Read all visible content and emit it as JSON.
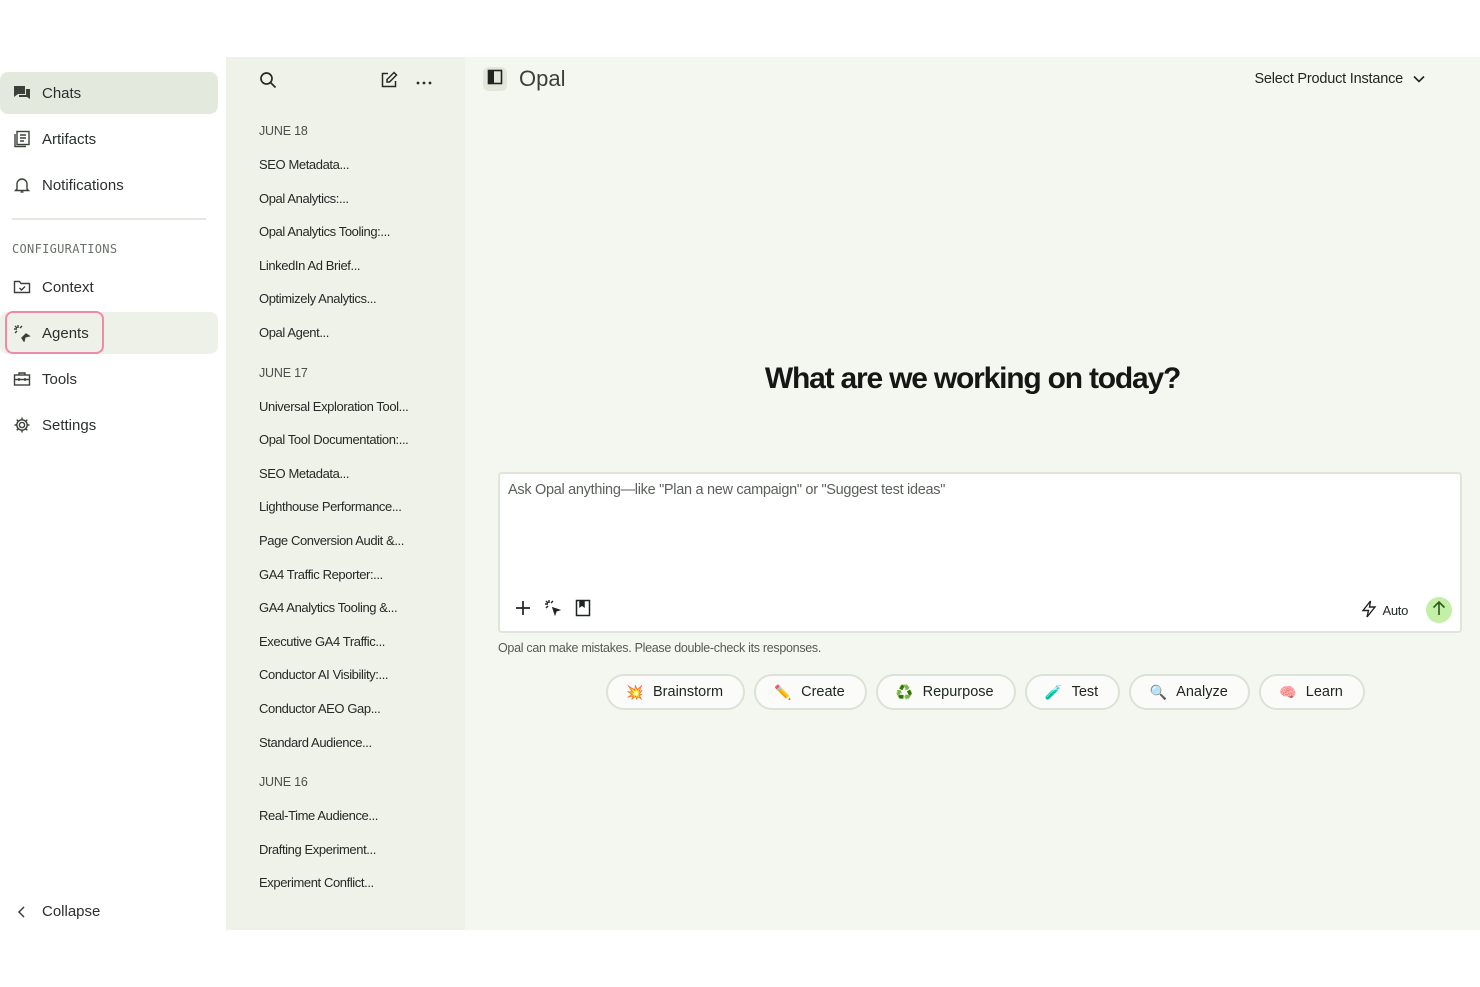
{
  "nav": {
    "items": [
      {
        "label": "Chats",
        "icon": "chat-icon"
      },
      {
        "label": "Artifacts",
        "icon": "artifacts-icon"
      },
      {
        "label": "Notifications",
        "icon": "bell-icon"
      }
    ],
    "section_label": "CONFIGURATIONS",
    "config_items": [
      {
        "label": "Context",
        "icon": "folder-icon"
      },
      {
        "label": "Agents",
        "icon": "agents-sparkle-icon"
      },
      {
        "label": "Tools",
        "icon": "toolbox-icon"
      },
      {
        "label": "Settings",
        "icon": "gear-icon"
      }
    ],
    "collapse_label": "Collapse",
    "highlight_color": "#f08aa8",
    "active_bg": "#e4e9de"
  },
  "history": {
    "groups": [
      {
        "label": "JUNE 18",
        "items": [
          "SEO Metadata...",
          "Opal Analytics:...",
          "Opal Analytics Tooling:...",
          "LinkedIn Ad Brief...",
          "Optimizely Analytics...",
          "Opal Agent..."
        ]
      },
      {
        "label": "JUNE 17",
        "items": [
          "Universal Exploration Tool...",
          "Opal Tool Documentation:...",
          "SEO Metadata...",
          "Lighthouse Performance...",
          "Page Conversion Audit &...",
          "GA4 Traffic Reporter:...",
          "GA4 Analytics Tooling &...",
          "Executive GA4 Traffic...",
          "Conductor AI Visibility:...",
          "Conductor AEO Gap...",
          "Standard Audience..."
        ]
      },
      {
        "label": "JUNE 16",
        "items": [
          "Real-Time Audience...",
          "Drafting Experiment...",
          "Experiment Conflict..."
        ]
      }
    ]
  },
  "main": {
    "title": "Opal",
    "instance_label": "Select Product Instance",
    "hero": "What are we working on today?",
    "composer": {
      "placeholder": "Ask Opal anything—like \"Plan a new campaign\" or \"Suggest test ideas\"",
      "mode_label": "Auto",
      "send_color": "#c3efa6"
    },
    "disclaimer": "Opal can make mistakes. Please double-check its responses.",
    "chips": [
      {
        "label": "Brainstorm",
        "icon": "sparkle-burst-icon",
        "emoji": "💥"
      },
      {
        "label": "Create",
        "icon": "pencil-icon",
        "emoji": "✏️"
      },
      {
        "label": "Repurpose",
        "icon": "recycle-icon",
        "emoji": "♻️"
      },
      {
        "label": "Test",
        "icon": "test-tube-icon",
        "emoji": "🧪"
      },
      {
        "label": "Analyze",
        "icon": "magnifier-icon",
        "emoji": "🔍"
      },
      {
        "label": "Learn",
        "icon": "brain-icon",
        "emoji": "🧠"
      }
    ]
  }
}
